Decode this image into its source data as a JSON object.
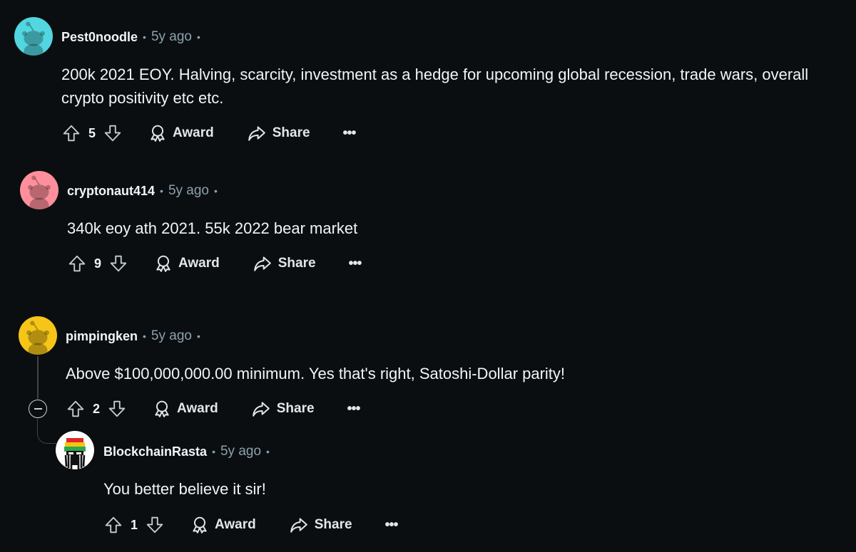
{
  "comments": [
    {
      "username": "Pest0noodle",
      "time": "5y ago",
      "text": "200k 2021 EOY. Halving, scarcity, investment as a hedge for upcoming global recession, trade wars, overall crypto positivity etc etc.",
      "votes": "5",
      "avatar_color": "#52d6e0"
    },
    {
      "username": "cryptonaut414",
      "time": "5y ago",
      "text": "340k eoy ath 2021. 55k 2022 bear market",
      "votes": "9",
      "avatar_color": "#ff8f9c"
    },
    {
      "username": "pimpingken",
      "time": "5y ago",
      "text": "Above $100,000,000.00 minimum. Yes that's right, Satoshi-Dollar parity!",
      "votes": "2",
      "avatar_color": "#f5c518"
    },
    {
      "username": "BlockchainRasta",
      "time": "5y ago",
      "text": "You better believe it sir!",
      "votes": "1",
      "avatar_color": "#ffffff"
    }
  ],
  "labels": {
    "award": "Award",
    "share": "Share",
    "more": "•••",
    "separator": "•"
  },
  "icons": {
    "upvote": "upvote-icon",
    "downvote": "downvote-icon",
    "award": "award-icon",
    "share": "share-icon",
    "collapse": "collapse-icon"
  },
  "colors": {
    "background": "#0b0e11",
    "text": "#f2f4f5",
    "meta": "#8ba2ad",
    "thread_line": "#3e4447"
  }
}
